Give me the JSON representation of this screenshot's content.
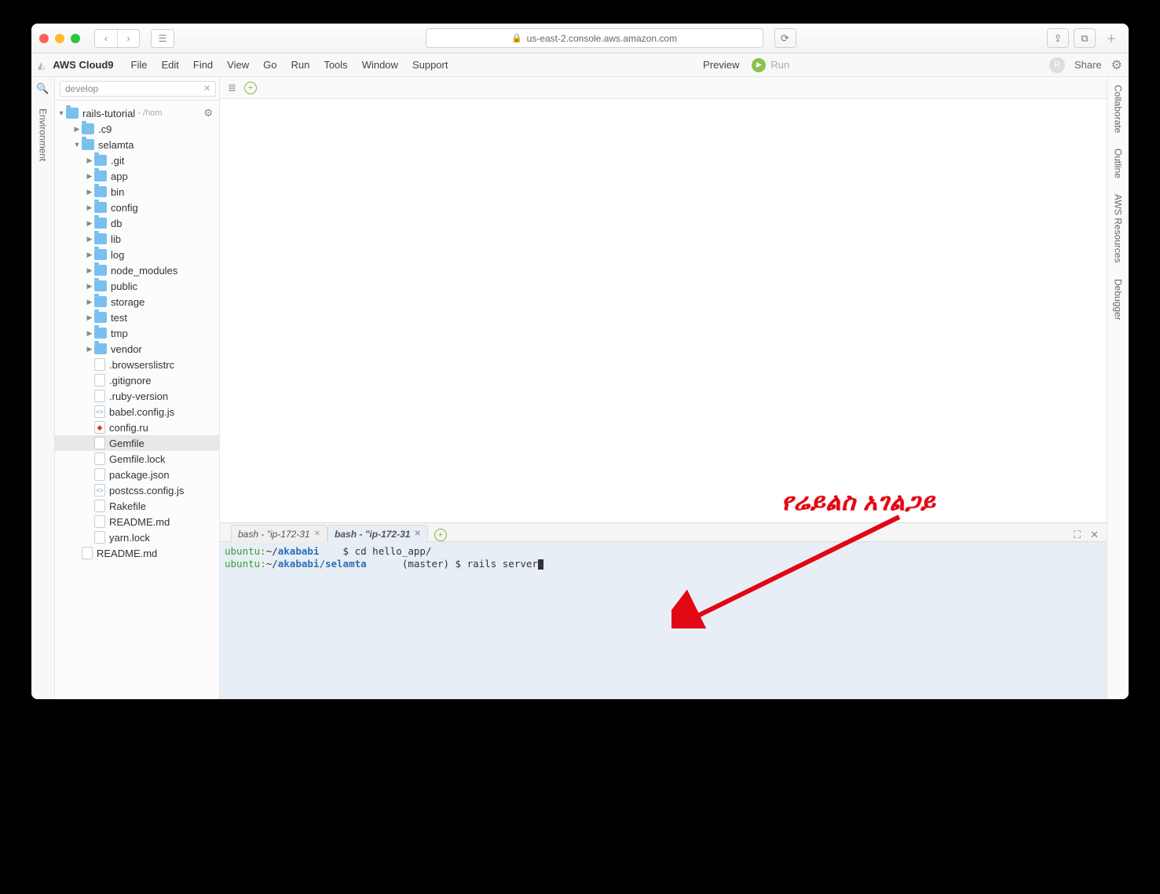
{
  "browser": {
    "url": "us-east-2.console.aws.amazon.com"
  },
  "menubar": {
    "title": "AWS Cloud9",
    "items": [
      "File",
      "Edit",
      "Find",
      "View",
      "Go",
      "Run",
      "Tools",
      "Window",
      "Support"
    ],
    "preview": "Preview",
    "run": "Run",
    "avatar": "R",
    "share": "Share"
  },
  "leftrail": {
    "label": "Environment"
  },
  "rightrail": {
    "items": [
      "Collaborate",
      "Outline",
      "AWS Resources",
      "Debugger"
    ]
  },
  "search": {
    "value": "develop"
  },
  "tree": {
    "root": {
      "name": "rails-tutorial",
      "hint": "- /hom"
    },
    "nodes": [
      {
        "depth": 1,
        "type": "folder",
        "caret": "▶",
        "name": ".c9"
      },
      {
        "depth": 1,
        "type": "folder",
        "caret": "▼",
        "name": "selamta"
      },
      {
        "depth": 2,
        "type": "folder",
        "caret": "▶",
        "name": ".git"
      },
      {
        "depth": 2,
        "type": "folder",
        "caret": "▶",
        "name": "app"
      },
      {
        "depth": 2,
        "type": "folder",
        "caret": "▶",
        "name": "bin"
      },
      {
        "depth": 2,
        "type": "folder",
        "caret": "▶",
        "name": "config"
      },
      {
        "depth": 2,
        "type": "folder",
        "caret": "▶",
        "name": "db"
      },
      {
        "depth": 2,
        "type": "folder",
        "caret": "▶",
        "name": "lib"
      },
      {
        "depth": 2,
        "type": "folder",
        "caret": "▶",
        "name": "log"
      },
      {
        "depth": 2,
        "type": "folder",
        "caret": "▶",
        "name": "node_modules"
      },
      {
        "depth": 2,
        "type": "folder",
        "caret": "▶",
        "name": "public"
      },
      {
        "depth": 2,
        "type": "folder",
        "caret": "▶",
        "name": "storage"
      },
      {
        "depth": 2,
        "type": "folder",
        "caret": "▶",
        "name": "test"
      },
      {
        "depth": 2,
        "type": "folder",
        "caret": "▶",
        "name": "tmp"
      },
      {
        "depth": 2,
        "type": "folder",
        "caret": "▶",
        "name": "vendor"
      },
      {
        "depth": 2,
        "type": "file",
        "cls": "",
        "name": ".browserslistrc"
      },
      {
        "depth": 2,
        "type": "file",
        "cls": "",
        "name": ".gitignore"
      },
      {
        "depth": 2,
        "type": "file",
        "cls": "",
        "name": ".ruby-version"
      },
      {
        "depth": 2,
        "type": "file",
        "cls": "js",
        "name": "babel.config.js"
      },
      {
        "depth": 2,
        "type": "file",
        "cls": "rb",
        "name": "config.ru"
      },
      {
        "depth": 2,
        "type": "file",
        "cls": "",
        "name": "Gemfile",
        "selected": true
      },
      {
        "depth": 2,
        "type": "file",
        "cls": "",
        "name": "Gemfile.lock"
      },
      {
        "depth": 2,
        "type": "file",
        "cls": "",
        "name": "package.json"
      },
      {
        "depth": 2,
        "type": "file",
        "cls": "js",
        "name": "postcss.config.js"
      },
      {
        "depth": 2,
        "type": "file",
        "cls": "",
        "name": "Rakefile"
      },
      {
        "depth": 2,
        "type": "file",
        "cls": "",
        "name": "README.md"
      },
      {
        "depth": 2,
        "type": "file",
        "cls": "",
        "name": "yarn.lock"
      },
      {
        "depth": 1,
        "type": "file",
        "cls": "",
        "name": "README.md"
      }
    ]
  },
  "terminal": {
    "tabs": [
      {
        "label": "bash - \"ip-172-31",
        "active": false
      },
      {
        "label": "bash - \"ip-172-31",
        "active": true
      }
    ],
    "lines": [
      {
        "user": "ubuntu",
        "host": "~/",
        "p1": "akababi",
        "p2": "",
        "branch": "",
        "prompt": "$ ",
        "cmd": "cd hello_app/"
      },
      {
        "user": "ubuntu",
        "host": "~/",
        "p1": "akababi",
        "sep": "/",
        "p2": "selamta",
        "branch": "(master) ",
        "prompt": "$ ",
        "cmd": "rails server"
      }
    ]
  },
  "annotation": {
    "text": "የሬይልስ አገልጋይ"
  }
}
